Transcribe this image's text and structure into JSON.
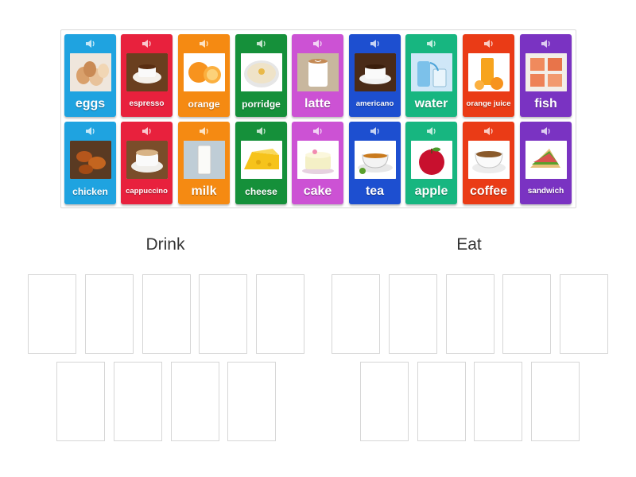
{
  "bank": {
    "row1": [
      {
        "id": "eggs",
        "label": "eggs",
        "color": "#1fa3e0",
        "size": "big",
        "icon": "eggs-photo"
      },
      {
        "id": "espresso",
        "label": "espresso",
        "color": "#e8213d",
        "size": "sm",
        "icon": "espresso-photo"
      },
      {
        "id": "orange",
        "label": "orange",
        "color": "#f58a12",
        "size": "med",
        "icon": "orange-photo"
      },
      {
        "id": "porridge",
        "label": "porridge",
        "color": "#15903a",
        "size": "med",
        "icon": "porridge-photo"
      },
      {
        "id": "latte",
        "label": "latte",
        "color": "#cc52d4",
        "size": "big",
        "icon": "latte-photo"
      },
      {
        "id": "americano",
        "label": "americano",
        "color": "#1d4fd0",
        "size": "xs",
        "icon": "americano-photo"
      },
      {
        "id": "water",
        "label": "water",
        "color": "#17b680",
        "size": "big",
        "icon": "water-photo"
      },
      {
        "id": "orange-juice",
        "label": "orange juice",
        "color": "#ea3b16",
        "size": "xs",
        "icon": "orange-juice-photo"
      },
      {
        "id": "fish",
        "label": "fish",
        "color": "#7a33c2",
        "size": "big",
        "icon": "fish-photo"
      }
    ],
    "row2": [
      {
        "id": "chicken",
        "label": "chicken",
        "color": "#1fa3e0",
        "size": "med",
        "icon": "chicken-photo"
      },
      {
        "id": "cappuccino",
        "label": "cappuccino",
        "color": "#e8213d",
        "size": "xs",
        "icon": "cappuccino-photo"
      },
      {
        "id": "milk",
        "label": "milk",
        "color": "#f58a12",
        "size": "big",
        "icon": "milk-photo"
      },
      {
        "id": "cheese",
        "label": "cheese",
        "color": "#15903a",
        "size": "med",
        "icon": "cheese-photo"
      },
      {
        "id": "cake",
        "label": "cake",
        "color": "#cc52d4",
        "size": "big",
        "icon": "cake-photo"
      },
      {
        "id": "tea",
        "label": "tea",
        "color": "#1d4fd0",
        "size": "big",
        "icon": "tea-photo"
      },
      {
        "id": "apple",
        "label": "apple",
        "color": "#17b680",
        "size": "big",
        "icon": "apple-photo"
      },
      {
        "id": "coffee",
        "label": "coffee",
        "color": "#ea3b16",
        "size": "big",
        "icon": "coffee-photo"
      },
      {
        "id": "sandwich",
        "label": "sandwich",
        "color": "#7a33c2",
        "size": "sm",
        "icon": "sandwich-photo"
      }
    ]
  },
  "groups": {
    "drink": {
      "title": "Drink"
    },
    "eat": {
      "title": "Eat"
    }
  }
}
